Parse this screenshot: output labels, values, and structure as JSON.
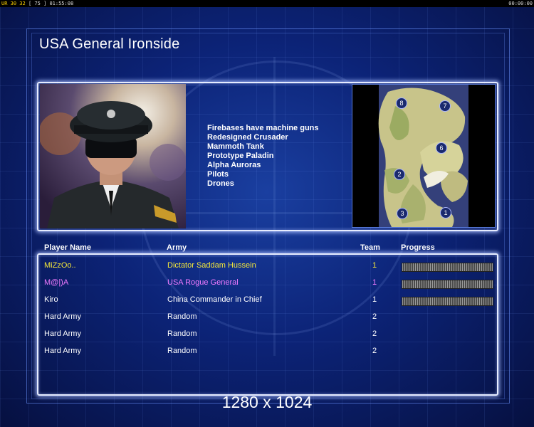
{
  "topbar": {
    "left_a": "UR 30 32",
    "left_b": "[ 75 ]",
    "left_time": "01:55:08",
    "right_time": "00:00:00"
  },
  "title": "USA General Ironside",
  "features": [
    "Firebases have machine guns",
    "Redesigned Crusader",
    "Mammoth Tank",
    "Prototype Paladin",
    "Alpha Auroras",
    "Pilots",
    "Drones"
  ],
  "minimap": {
    "starts": [
      "8",
      "7",
      "6",
      "2",
      "3",
      "1"
    ]
  },
  "table": {
    "headers": {
      "name": "Player Name",
      "army": "Army",
      "team": "Team",
      "progress": "Progress"
    },
    "rows": [
      {
        "name": "MiZzOo..",
        "army": "Dictator Saddam Hussein",
        "team": "1",
        "color": "#f2e63a",
        "progress": 1.0
      },
      {
        "name": "M@|)A",
        "army": "USA Rogue General",
        "team": "1",
        "color": "#f07aff",
        "progress": 1.0
      },
      {
        "name": "Kiro",
        "army": "China Commander in Chief",
        "team": "1",
        "color": "#ffffff",
        "progress": 1.0
      },
      {
        "name": "Hard Army",
        "army": "Random",
        "team": "2",
        "color": "#ffffff",
        "progress": null
      },
      {
        "name": "Hard Army",
        "army": "Random",
        "team": "2",
        "color": "#ffffff",
        "progress": null
      },
      {
        "name": "Hard Army",
        "army": "Random",
        "team": "2",
        "color": "#ffffff",
        "progress": null
      }
    ]
  },
  "resolution": "1280 x 1024"
}
